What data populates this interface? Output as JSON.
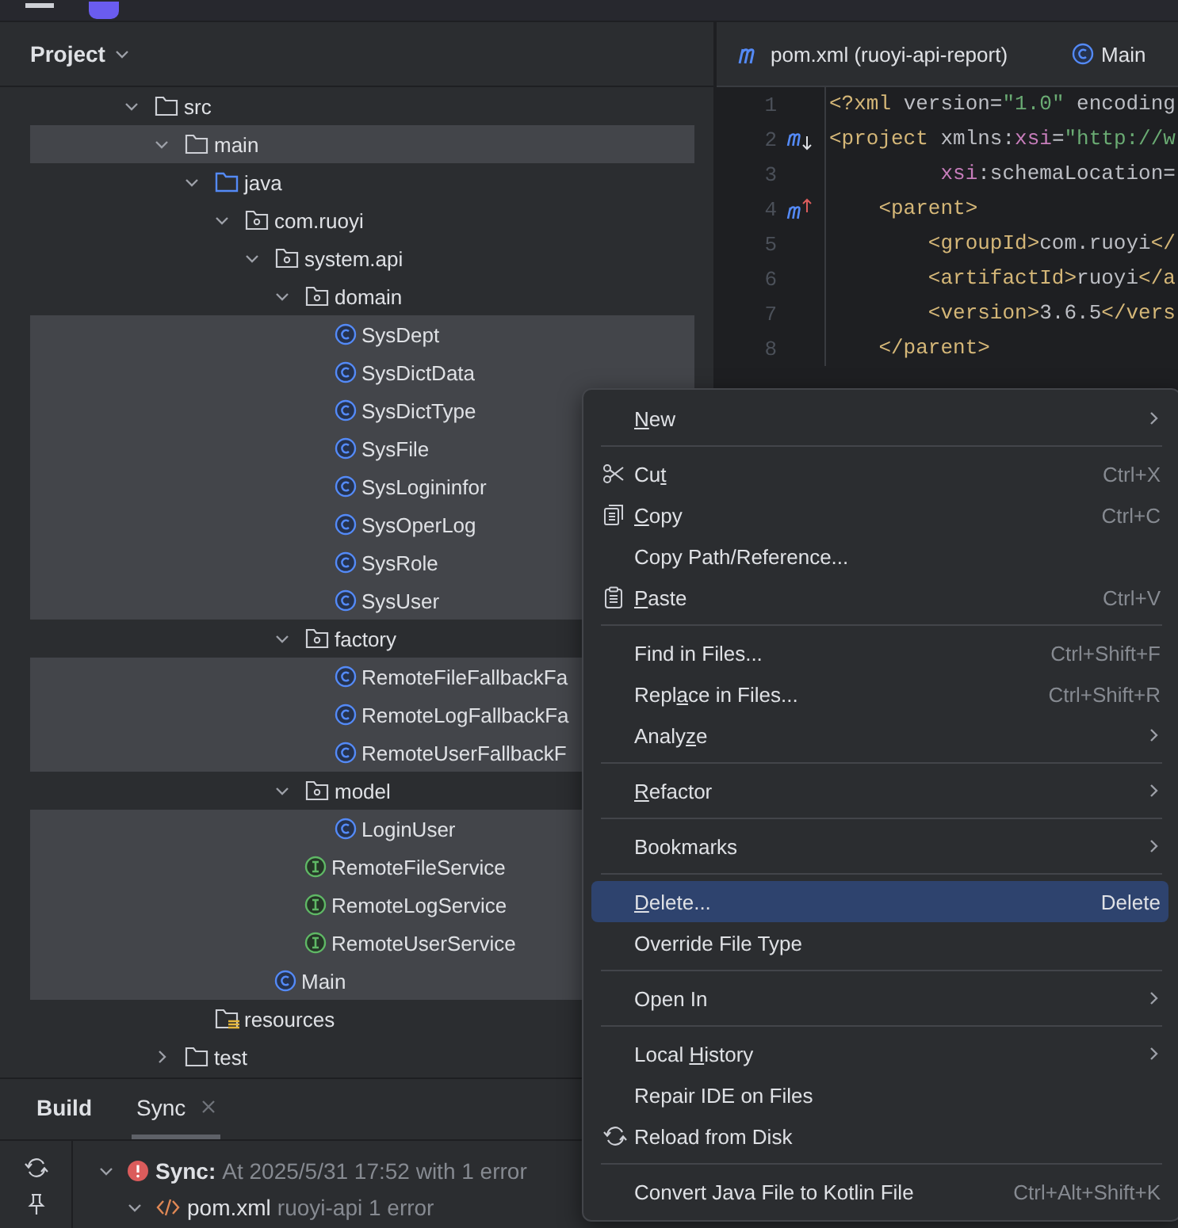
{
  "project_panel": {
    "title": "Project",
    "tree": [
      {
        "label": "src",
        "kind": "folder",
        "expanded": true,
        "selected": false,
        "children": [
          {
            "label": "main",
            "kind": "folder",
            "expanded": true,
            "selected": true,
            "children": [
              {
                "label": "java",
                "kind": "source-root",
                "expanded": true,
                "selected": false,
                "children": [
                  {
                    "label": "com.ruoyi",
                    "kind": "package",
                    "expanded": true,
                    "selected": false,
                    "children": [
                      {
                        "label": "system.api",
                        "kind": "package",
                        "expanded": true,
                        "selected": false,
                        "children": [
                          {
                            "label": "domain",
                            "kind": "package",
                            "expanded": true,
                            "selected": false,
                            "children": [
                              {
                                "label": "SysDept",
                                "kind": "class",
                                "selected": true
                              },
                              {
                                "label": "SysDictData",
                                "kind": "class",
                                "selected": true
                              },
                              {
                                "label": "SysDictType",
                                "kind": "class",
                                "selected": true
                              },
                              {
                                "label": "SysFile",
                                "kind": "class",
                                "selected": true
                              },
                              {
                                "label": "SysLogininfor",
                                "kind": "class",
                                "selected": true
                              },
                              {
                                "label": "SysOperLog",
                                "kind": "class",
                                "selected": true
                              },
                              {
                                "label": "SysRole",
                                "kind": "class",
                                "selected": true
                              },
                              {
                                "label": "SysUser",
                                "kind": "class",
                                "selected": true
                              }
                            ]
                          },
                          {
                            "label": "factory",
                            "kind": "package",
                            "expanded": true,
                            "selected": false,
                            "children": [
                              {
                                "label": "RemoteFileFallbackFa",
                                "kind": "class",
                                "selected": true
                              },
                              {
                                "label": "RemoteLogFallbackFa",
                                "kind": "class",
                                "selected": true
                              },
                              {
                                "label": "RemoteUserFallbackF",
                                "kind": "class",
                                "selected": true
                              }
                            ]
                          },
                          {
                            "label": "model",
                            "kind": "package",
                            "expanded": true,
                            "selected": false,
                            "children": [
                              {
                                "label": "LoginUser",
                                "kind": "class",
                                "selected": true
                              }
                            ]
                          },
                          {
                            "label": "RemoteFileService",
                            "kind": "interface",
                            "selected": true
                          },
                          {
                            "label": "RemoteLogService",
                            "kind": "interface",
                            "selected": true
                          },
                          {
                            "label": "RemoteUserService",
                            "kind": "interface",
                            "selected": true
                          }
                        ]
                      },
                      {
                        "label": "Main",
                        "kind": "class",
                        "selected": true
                      }
                    ]
                  }
                ]
              },
              {
                "label": "resources",
                "kind": "resources-root",
                "selected": false
              }
            ]
          },
          {
            "label": "test",
            "kind": "folder",
            "expanded": false,
            "selected": false
          }
        ]
      }
    ]
  },
  "editor": {
    "tabs": [
      {
        "label": "pom.xml (ruoyi-api-report)",
        "kind": "maven"
      },
      {
        "label": "Main",
        "kind": "class"
      }
    ],
    "lines": [
      {
        "number": "1",
        "kind": "plain",
        "segments": [
          {
            "kind": "tag",
            "text": "<?xml"
          },
          {
            "kind": "attr",
            "text": " version="
          },
          {
            "kind": "string",
            "text": "\"1.0\""
          },
          {
            "kind": "attr",
            "text": " encoding"
          }
        ]
      },
      {
        "number": "2",
        "kind": "implemented",
        "segments": [
          {
            "kind": "tag",
            "text": "<project"
          },
          {
            "kind": "attr",
            "text": " xmlns:"
          },
          {
            "kind": "ns",
            "text": "xsi"
          },
          {
            "kind": "attr",
            "text": "="
          },
          {
            "kind": "string",
            "text": "\"http://w"
          }
        ]
      },
      {
        "number": "3",
        "kind": "plain",
        "segments": [
          {
            "kind": "ns",
            "text": "         xsi"
          },
          {
            "kind": "attr",
            "text": ":schemaLocation="
          }
        ]
      },
      {
        "number": "4",
        "kind": "overriding",
        "segments": [
          {
            "kind": "tag",
            "text": "    <parent>"
          }
        ]
      },
      {
        "number": "5",
        "kind": "plain",
        "segments": [
          {
            "kind": "tag",
            "text": "        <groupId>"
          },
          {
            "kind": "text",
            "text": "com.ruoyi"
          },
          {
            "kind": "tag",
            "text": "</"
          }
        ]
      },
      {
        "number": "6",
        "kind": "plain",
        "segments": [
          {
            "kind": "tag",
            "text": "        <artifactId>"
          },
          {
            "kind": "text",
            "text": "ruoyi"
          },
          {
            "kind": "tag",
            "text": "</a"
          }
        ]
      },
      {
        "number": "7",
        "kind": "plain",
        "segments": [
          {
            "kind": "tag",
            "text": "        <version>"
          },
          {
            "kind": "text",
            "text": "3.6.5"
          },
          {
            "kind": "tag",
            "text": "</vers"
          }
        ]
      },
      {
        "number": "8",
        "kind": "plain",
        "segments": [
          {
            "kind": "tag",
            "text": "    </parent>"
          }
        ]
      }
    ]
  },
  "build_panel": {
    "tabs": [
      {
        "label": "Build",
        "selected": false,
        "closable": false
      },
      {
        "label": "Sync",
        "selected": true,
        "closable": true
      }
    ],
    "rows": [
      {
        "kind": "error",
        "title": "Sync:",
        "detail": "At 2025/5/31 17:52 with 1 error",
        "expanded": true,
        "children": [
          {
            "kind": "xml",
            "title": "pom.xml",
            "detail": "ruoyi-api 1 error",
            "expanded": true
          }
        ]
      }
    ]
  },
  "context_menu": {
    "items": [
      {
        "kind": "plain",
        "mnemonic": "N",
        "label_end": "ew",
        "submenu": true,
        "selected": false
      },
      {
        "kind": "separator"
      },
      {
        "kind": "scissors",
        "label_start": "Cu",
        "mnemonic": "t",
        "shortcut": "Ctrl+X",
        "submenu": false,
        "selected": false
      },
      {
        "kind": "copy",
        "mnemonic": "C",
        "label_end": "opy",
        "shortcut": "Ctrl+C",
        "submenu": false,
        "selected": false
      },
      {
        "kind": "plain",
        "label_start": "Copy Path/Reference...",
        "submenu": false,
        "selected": false
      },
      {
        "kind": "paste",
        "mnemonic": "P",
        "label_end": "aste",
        "shortcut": "Ctrl+V",
        "submenu": false,
        "selected": false
      },
      {
        "kind": "separator"
      },
      {
        "kind": "plain",
        "label_start": "Find in Files...",
        "shortcut": "Ctrl+Shift+F",
        "submenu": false,
        "selected": false
      },
      {
        "kind": "plain",
        "label_start": "Repl",
        "mnemonic": "a",
        "label_end": "ce in Files...",
        "shortcut": "Ctrl+Shift+R",
        "submenu": false,
        "selected": false
      },
      {
        "kind": "plain",
        "label_start": "Analy",
        "mnemonic": "z",
        "label_end": "e",
        "submenu": true,
        "selected": false
      },
      {
        "kind": "separator"
      },
      {
        "kind": "plain",
        "mnemonic": "R",
        "label_end": "efactor",
        "submenu": true,
        "selected": false
      },
      {
        "kind": "separator"
      },
      {
        "kind": "plain",
        "label_start": "Bookmarks",
        "submenu": true,
        "selected": false
      },
      {
        "kind": "separator"
      },
      {
        "kind": "plain",
        "mnemonic": "D",
        "label_end": "elete...",
        "shortcut": "Delete",
        "submenu": false,
        "selected": true
      },
      {
        "kind": "plain",
        "label_start": "Override File Type",
        "submenu": false,
        "selected": false
      },
      {
        "kind": "separator"
      },
      {
        "kind": "plain",
        "label_start": "Open In",
        "submenu": true,
        "selected": false
      },
      {
        "kind": "separator"
      },
      {
        "kind": "plain",
        "label_start": "Local ",
        "mnemonic": "H",
        "label_end": "istory",
        "submenu": true,
        "selected": false
      },
      {
        "kind": "plain",
        "label_start": "Repair IDE on Files",
        "submenu": false,
        "selected": false
      },
      {
        "kind": "reload",
        "label_start": "Reload from Disk",
        "submenu": false,
        "selected": false
      },
      {
        "kind": "separator"
      },
      {
        "kind": "plain",
        "label_start": "Convert Java File to Kotlin File",
        "shortcut": "Ctrl+Alt+Shift+K",
        "submenu": false,
        "selected": false
      }
    ]
  }
}
